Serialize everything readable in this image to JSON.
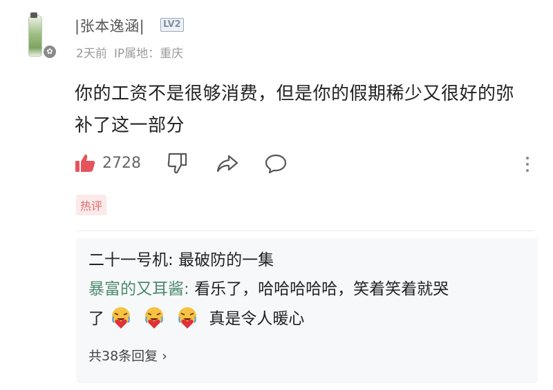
{
  "comment": {
    "username": "|张本逸涵|",
    "level": "LV2",
    "time": "2天前",
    "location": "IP属地：重庆",
    "text": "你的工资不是很够消费，但是你的假期稀少又很好的弥补了这一部分",
    "likes": "2728",
    "hot_tag": "热评"
  },
  "replies": [
    {
      "name": "二十一号机",
      "sep": ": ",
      "text": "最破防的一集"
    },
    {
      "name": "暴富的又耳酱",
      "sep": ": ",
      "text": "看乐了，哈哈哈哈哈，笑着笑着就哭",
      "cont_prefix": "了",
      "cont_text": "真是令人暖心",
      "emoji": [
        "laugh-cry-heart-icon",
        "laugh-cry-heart-icon",
        "laugh-cry-heart-icon"
      ]
    }
  ],
  "more_replies": "共38条回复 ›",
  "colors": {
    "reply_name": "#4c8a6e",
    "hot_tag": "#e06a6a",
    "meta": "#9a9a9a"
  }
}
